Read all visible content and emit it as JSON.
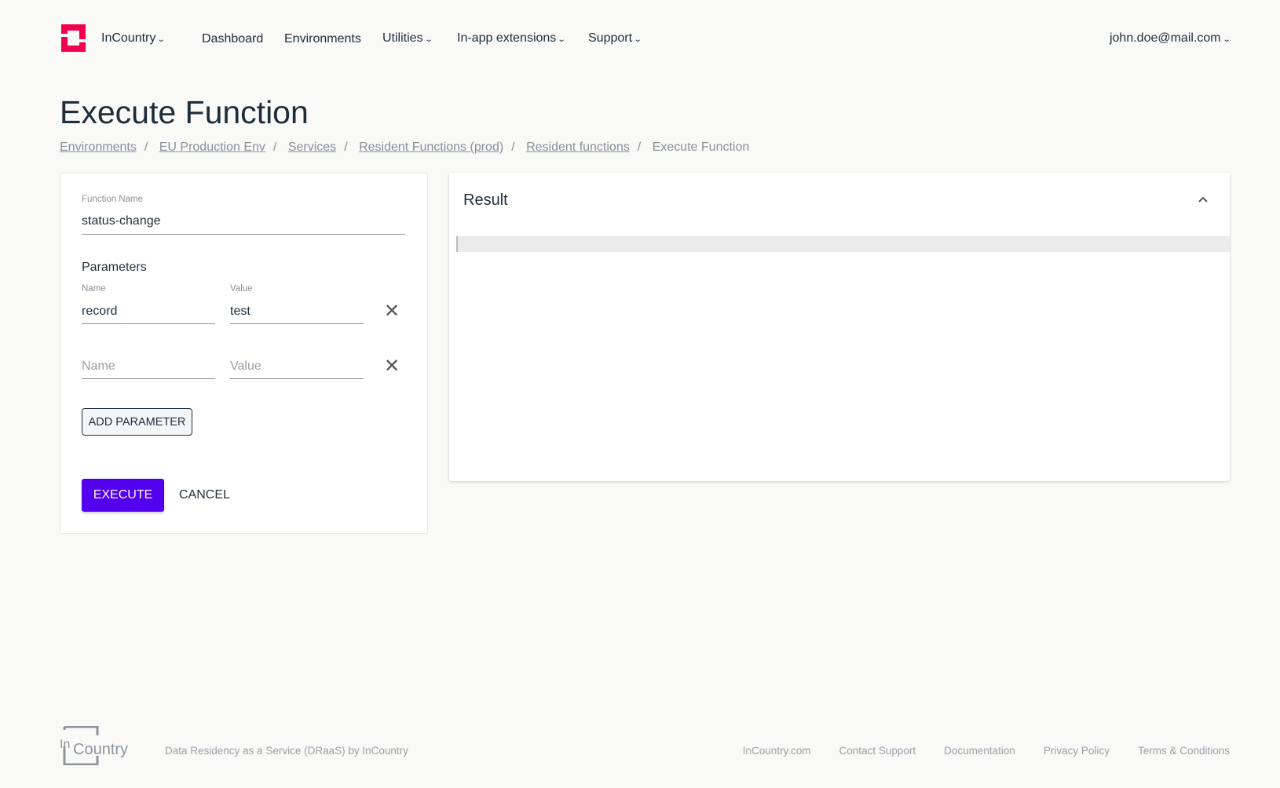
{
  "header": {
    "brand": "InCountry",
    "nav": [
      "Dashboard",
      "Environments",
      "Utilities",
      "In-app extensions",
      "Support"
    ],
    "user": "john.doe@mail.com"
  },
  "page": {
    "title": "Execute Function",
    "breadcrumb": [
      "Environments",
      "EU Production Env",
      "Services",
      "Resident Functions (prod)",
      "Resident functions",
      "Execute Function"
    ]
  },
  "form": {
    "function_name_label": "Function Name",
    "function_name_value": "status-change",
    "parameters_label": "Parameters",
    "name_label": "Name",
    "value_label": "Value",
    "params": [
      {
        "name": "record",
        "value": "test"
      }
    ],
    "name_placeholder": "Name",
    "value_placeholder": "Value",
    "add_parameter": "ADD PARAMETER",
    "execute": "EXECUTE",
    "cancel": "CANCEL"
  },
  "result": {
    "title": "Result",
    "content": ""
  },
  "footer": {
    "logo_text": "InCountry",
    "tagline": "Data Residency as a Service (DRaaS) by InCountry",
    "links": [
      "InCountry.com",
      "Contact Support",
      "Documentation",
      "Privacy Policy",
      "Terms & Conditions"
    ]
  },
  "colors": {
    "brand": "#f0004f",
    "primary": "#5200ee"
  }
}
